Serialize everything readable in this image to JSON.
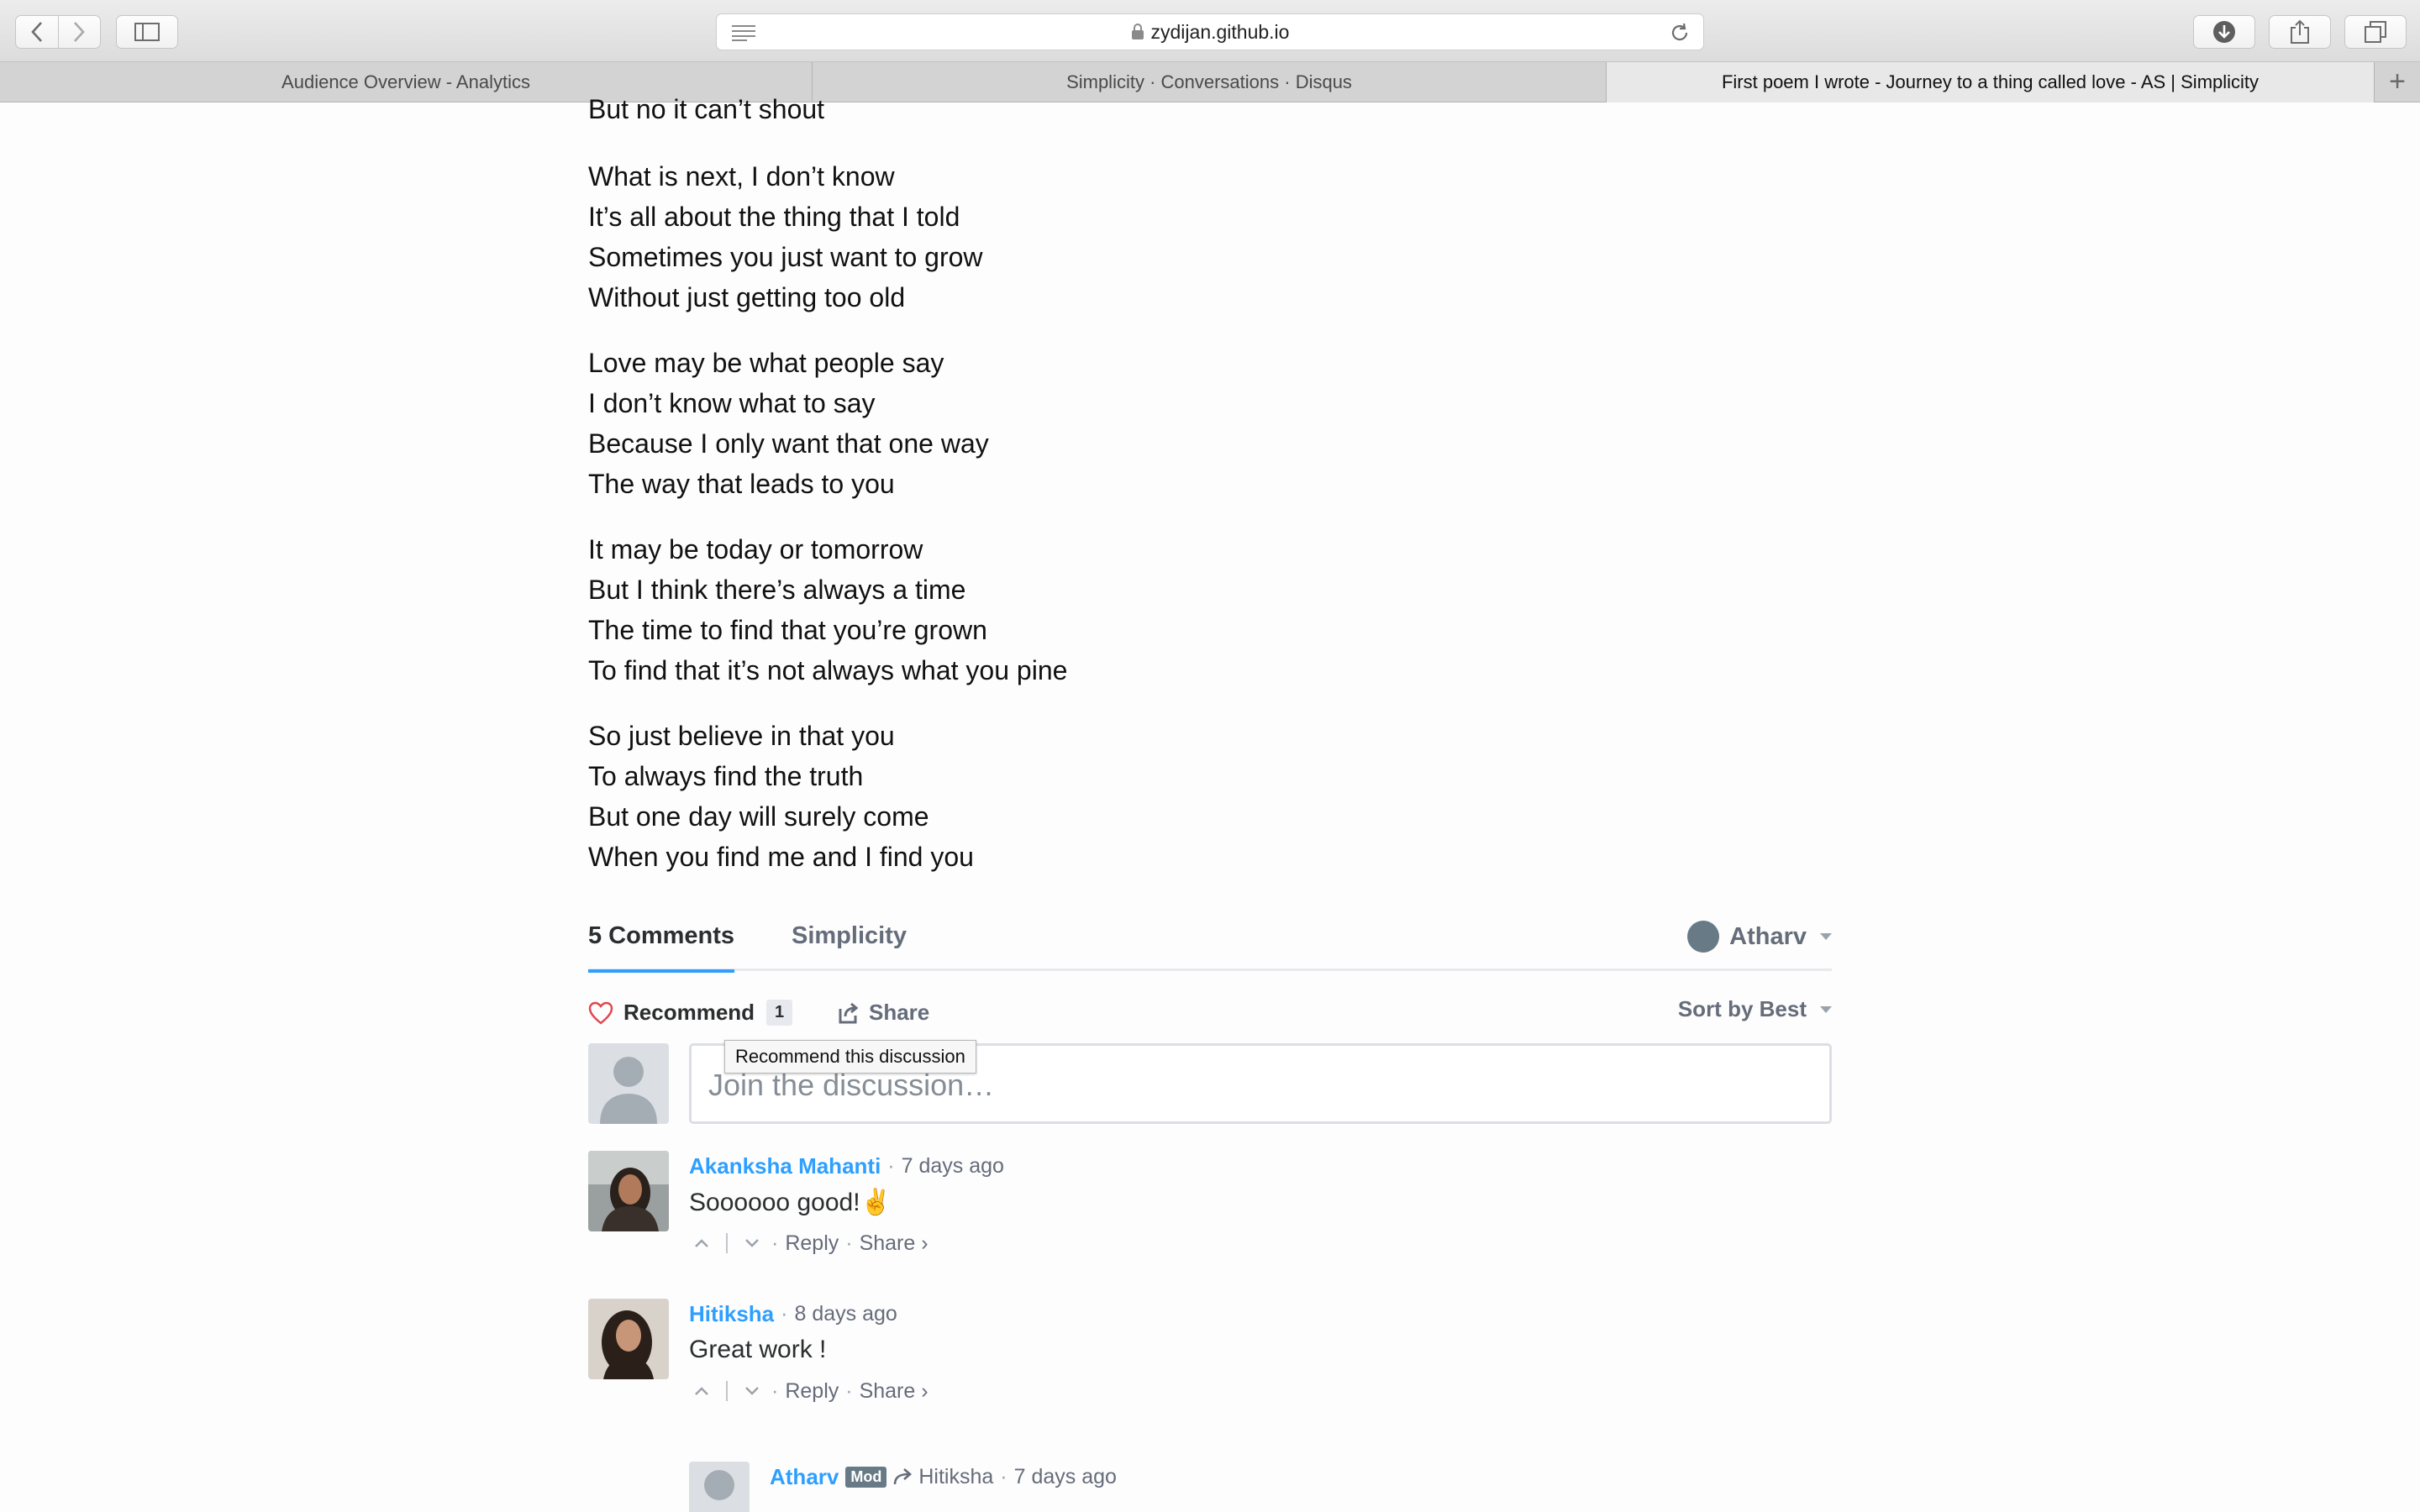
{
  "browser": {
    "url": "zydijan.github.io",
    "tabs": [
      {
        "title": "Audience Overview - Analytics",
        "active": false
      },
      {
        "title": "Simplicity · Conversations · Disqus",
        "active": false
      },
      {
        "title": "First poem I wrote - Journey to a thing called love - AS | Simplicity",
        "active": true
      }
    ]
  },
  "poem": {
    "partial_line": "But no it can’t shout",
    "stanzas": [
      [
        "What is next, I don’t know",
        "It’s all about the thing that I told",
        "Sometimes you just want to grow",
        "Without just getting too old"
      ],
      [
        "Love may be what people say",
        "I don’t know what to say",
        "Because I only want that one way",
        "The way that leads to you"
      ],
      [
        "It may be today or tomorrow",
        "But I think there’s always a time",
        "The time to find that you’re grown",
        "To find that it’s not always what you pine"
      ],
      [
        "So just believe in that you",
        "To always find the truth",
        "But one day will surely come",
        "When you find me and I find you"
      ]
    ]
  },
  "disqus": {
    "comment_count_label": "5 Comments",
    "forum_tab": "Simplicity",
    "user_name": "Atharv",
    "recommend_label": "Recommend",
    "recommend_count": "1",
    "share_label": "Share",
    "sort_label": "Sort by Best",
    "tooltip": "Recommend this discussion",
    "compose_placeholder": "Join the discussion…",
    "comments": [
      {
        "author": "Akanksha Mahanti",
        "time": "7 days ago",
        "text": "Soooooo good!✌",
        "reply": "Reply",
        "share": "Share ›"
      },
      {
        "author": "Hitiksha",
        "time": "8 days ago",
        "text": "Great work !",
        "reply": "Reply",
        "share": "Share ›"
      }
    ],
    "reply": {
      "author": "Atharv",
      "badge": "Mod",
      "in_reply_to": "Hitiksha",
      "time": "7 days ago"
    }
  },
  "colors": {
    "accent": "#2e9fff",
    "muted": "#656c7a",
    "heart": "#e0464e"
  }
}
